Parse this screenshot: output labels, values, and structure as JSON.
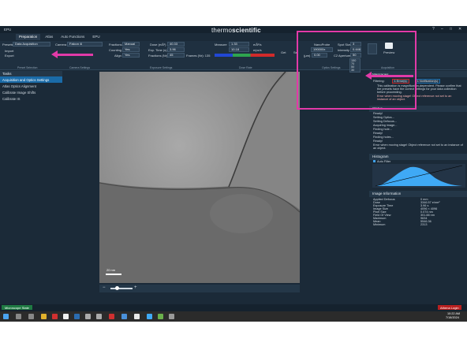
{
  "app": {
    "title": "EPU",
    "brand_light": "thermo",
    "brand_bold": "scientific"
  },
  "window_controls": [
    "?",
    "–",
    "□",
    "✕"
  ],
  "tabs": [
    {
      "label": "Preparation",
      "active": true
    },
    {
      "label": "Atlas",
      "active": false
    },
    {
      "label": "Auto Functions",
      "active": false
    },
    {
      "label": "EPU",
      "active": false
    }
  ],
  "ribbon": {
    "presets_label": "Presets",
    "preset_value": "Data Acquisition",
    "import_label": "Import",
    "export_label": "Export",
    "camera_label": "Camera",
    "camera_value": "Falcon 4i",
    "fractions_label": "Fractions",
    "fractions_value": "Manual",
    "counting_label": "Counting",
    "counting_value": "Yes",
    "align_label": "Align",
    "align_value": "Yes",
    "dose_label": "Dose (e/Å²)",
    "dose_value": "40.33",
    "exptime_label": "Exp. Time (s)",
    "exptime_value": "3.96",
    "fractions_nr_label": "Fractions (Nr)",
    "fractions_nr_value": "45",
    "frames_label": "Frames (Nr): 135",
    "measure_label": "Measure",
    "dose_rate_1": "1.33",
    "dose_rate_2": "10.18",
    "dose_unit_1": "e/Å²/s",
    "dose_unit_2": "e/px/s",
    "get_label": "Get",
    "set_label": "Set",
    "probe_value": "NanoProbe",
    "spot_size_label": "Spot Size",
    "spot_size_value": "3",
    "mag_value": "190000x",
    "intensity_label": "Intensity",
    "intensity_value": "0.446",
    "um_label": "(μm)",
    "um_value": "0.00",
    "c2_label": "C2 Aperture",
    "c2_value": "50",
    "aperture_options": [
      "150",
      "70",
      "50",
      "30"
    ],
    "preview_label": "Preview",
    "acquisition_label": "Acquisition",
    "sections": [
      "Preset Selection",
      "Camera Settings",
      "Exposure Settings",
      "Dose Rate",
      "Optics Settings"
    ]
  },
  "left": {
    "header": "Tasks",
    "items": [
      {
        "label": "Acquisition and Optics Settings",
        "selected": true
      },
      {
        "label": "Atlas Optics Alignment",
        "selected": false
      },
      {
        "label": "Calibrate Image Shifts",
        "selected": false
      },
      {
        "label": "Calibrate IS",
        "selected": false
      }
    ]
  },
  "image": {
    "scale_label": "20 nm"
  },
  "right": {
    "messages_header": "Messages",
    "filtering_label": "Filtering:",
    "errors_badge": "1 Error(s)",
    "notifications_badge": "1 Notification(s)",
    "message_1": "This calibration is magnification-dependent. Please confirm that the presets have the correct settings for your data collection before proceeding.",
    "message_2": "Error when moving stage! Object reference not set to an instance of an object.",
    "status_header": "Status",
    "status_lines": [
      "Ready!",
      "Setting Optics...",
      "Setting Defocus...",
      "Acquiring image...",
      "Finding hole...",
      "Ready!",
      "Finding holes...",
      "Ready!",
      "Error when moving stage! Object reference not set to an instance of an object."
    ],
    "histogram_header": "Histogram",
    "autofilter_label": "Auto Filter",
    "imageinfo_header": "Image Information",
    "info": [
      [
        "Applied Defocus",
        "0 mm"
      ],
      [
        "Dose",
        "3346.57 e/nm²"
      ],
      [
        "Exposure Time",
        "3.96 s"
      ],
      [
        "Image Size",
        "4096 × 4096"
      ],
      [
        "Pixel Size",
        "0.074 nm"
      ],
      [
        "Field Of View",
        "301.88 nm"
      ],
      [
        "Maximum",
        "9634"
      ],
      [
        "Mean",
        "5546.36"
      ],
      [
        "Minimum",
        "2313"
      ]
    ]
  },
  "statusbar": {
    "microscope_state": "Microscope State",
    "athena_login": "Athena Login"
  },
  "taskbar": {
    "time": "10:22 AM",
    "date": "7/18/2024"
  }
}
